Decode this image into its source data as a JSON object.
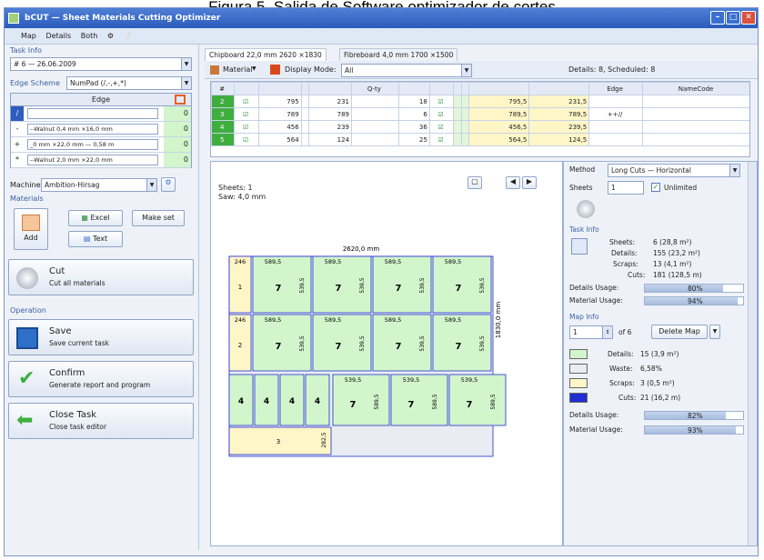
{
  "caption": "Figura 5. Salida de Software optimizador de cortes",
  "window": {
    "title": "bCUT — Sheet Materials Cutting Optimizer"
  },
  "menu": [
    "Map",
    "Details",
    "Both"
  ],
  "task": {
    "section": "Task Info",
    "name": "# 6 — 26.06.2009",
    "edge_scheme_label": "Edge Scheme",
    "edge_scheme": "NumPad (/,-,+,*)",
    "edge_header": "Edge",
    "edges": [
      {
        "key": "/",
        "name": "",
        "val": "0"
      },
      {
        "key": "-",
        "name": "--Walnut 0,4 mm ×16,0 mm",
        "val": "0"
      },
      {
        "key": "+",
        "name": "_0 mm ×22,0 mm — 0,58 m",
        "val": "0"
      },
      {
        "key": "*",
        "name": "--Walnut 2,0 mm ×22,0 mm",
        "val": "0"
      }
    ],
    "machine_label": "Machine",
    "machine": "Ambition-Hirsag"
  },
  "materials": {
    "label": "Materials",
    "add": "Add",
    "excel": "Excel",
    "make_set": "Make set",
    "text": "Text",
    "cut_title": "Cut",
    "cut_sub": "Cut all materials"
  },
  "operation": {
    "label": "Operation",
    "save_title": "Save",
    "save_sub": "Save current task",
    "confirm_title": "Confirm",
    "confirm_sub": "Generate report and program",
    "close_title": "Close Task",
    "close_sub": "Close task editor"
  },
  "tabs": [
    "Chipboard 22,0 mm 2620 ×1830",
    "Fibreboard 4,0 mm 1700 ×1500"
  ],
  "toolbar": {
    "material": "Material",
    "display_mode_label": "Display Mode:",
    "display_mode": "All",
    "details_summary": "Details: 8, Scheduled: 8"
  },
  "grid": {
    "headers": [
      "#",
      "",
      "",
      "",
      "",
      "Q-ty",
      "",
      "",
      "",
      "",
      "",
      "",
      "Edge",
      "NameCode"
    ],
    "rows": [
      {
        "n": "2",
        "a": "795",
        "b": "231",
        "q": "18",
        "c": "795,5",
        "d": "231,5",
        "e": ""
      },
      {
        "n": "3",
        "a": "789",
        "b": "789",
        "q": "6",
        "c": "789,5",
        "d": "789,5",
        "e": "++//"
      },
      {
        "n": "4",
        "a": "456",
        "b": "239",
        "q": "36",
        "c": "456,5",
        "d": "239,5",
        "e": ""
      },
      {
        "n": "5",
        "a": "564",
        "b": "124",
        "q": "25",
        "c": "564,5",
        "d": "124,5",
        "e": ""
      }
    ]
  },
  "map": {
    "sheets": "Sheets: 1",
    "saw": "Saw: 4,0 mm",
    "width": "2620,0 mm",
    "height": "1830,0 mm",
    "r1": {
      "s": "246",
      "c": "589,5",
      "h": "539,5",
      "a": "1",
      "v": "7"
    },
    "r2": {
      "s": "246",
      "c": "589,5",
      "h": "539,5",
      "a": "2",
      "v": "7"
    },
    "r3": {
      "l": "4",
      "c": "539,5",
      "h": "589,5",
      "v": "7"
    },
    "r4": {
      "n": "3",
      "h": "282,5"
    }
  },
  "right": {
    "method_label": "Method",
    "method": "Long Cuts — Horizontal",
    "sheets_label": "Sheets",
    "sheets_val": "1",
    "unlimited": "Unlimited",
    "task_info": "Task Info",
    "t_sheets_l": "Sheets:",
    "t_sheets": "6 (28,8 m²)",
    "t_details_l": "Details:",
    "t_details": "155 (23,2 m²)",
    "t_scraps_l": "Scraps:",
    "t_scraps": "13 (4,1 m²)",
    "t_cuts_l": "Cuts:",
    "t_cuts": "181 (128,5 m)",
    "du_l": "Details Usage:",
    "du": "80%",
    "du_v": 0.8,
    "mu_l": "Material Usage:",
    "mu": "94%",
    "mu_v": 0.94,
    "map_info": "Map Info",
    "map_no": "1",
    "of": "of 6",
    "delete": "Delete Map",
    "m_details_l": "Details:",
    "m_details": "15 (3,9 m²)",
    "m_waste_l": "Waste:",
    "m_waste": "6,58%",
    "m_scraps_l": "Scraps:",
    "m_scraps": "3 (0,5 m²)",
    "m_cuts_l": "Cuts:",
    "m_cuts": "21 (16,2 m)",
    "du2": "82%",
    "du2_v": 0.82,
    "mu2": "93%",
    "mu2_v": 0.93
  },
  "colors": {
    "detail": "#d3f5cc",
    "scrap": "#fff6c8",
    "waste": "#e9ecf2",
    "cut": "#1f2fd0"
  }
}
